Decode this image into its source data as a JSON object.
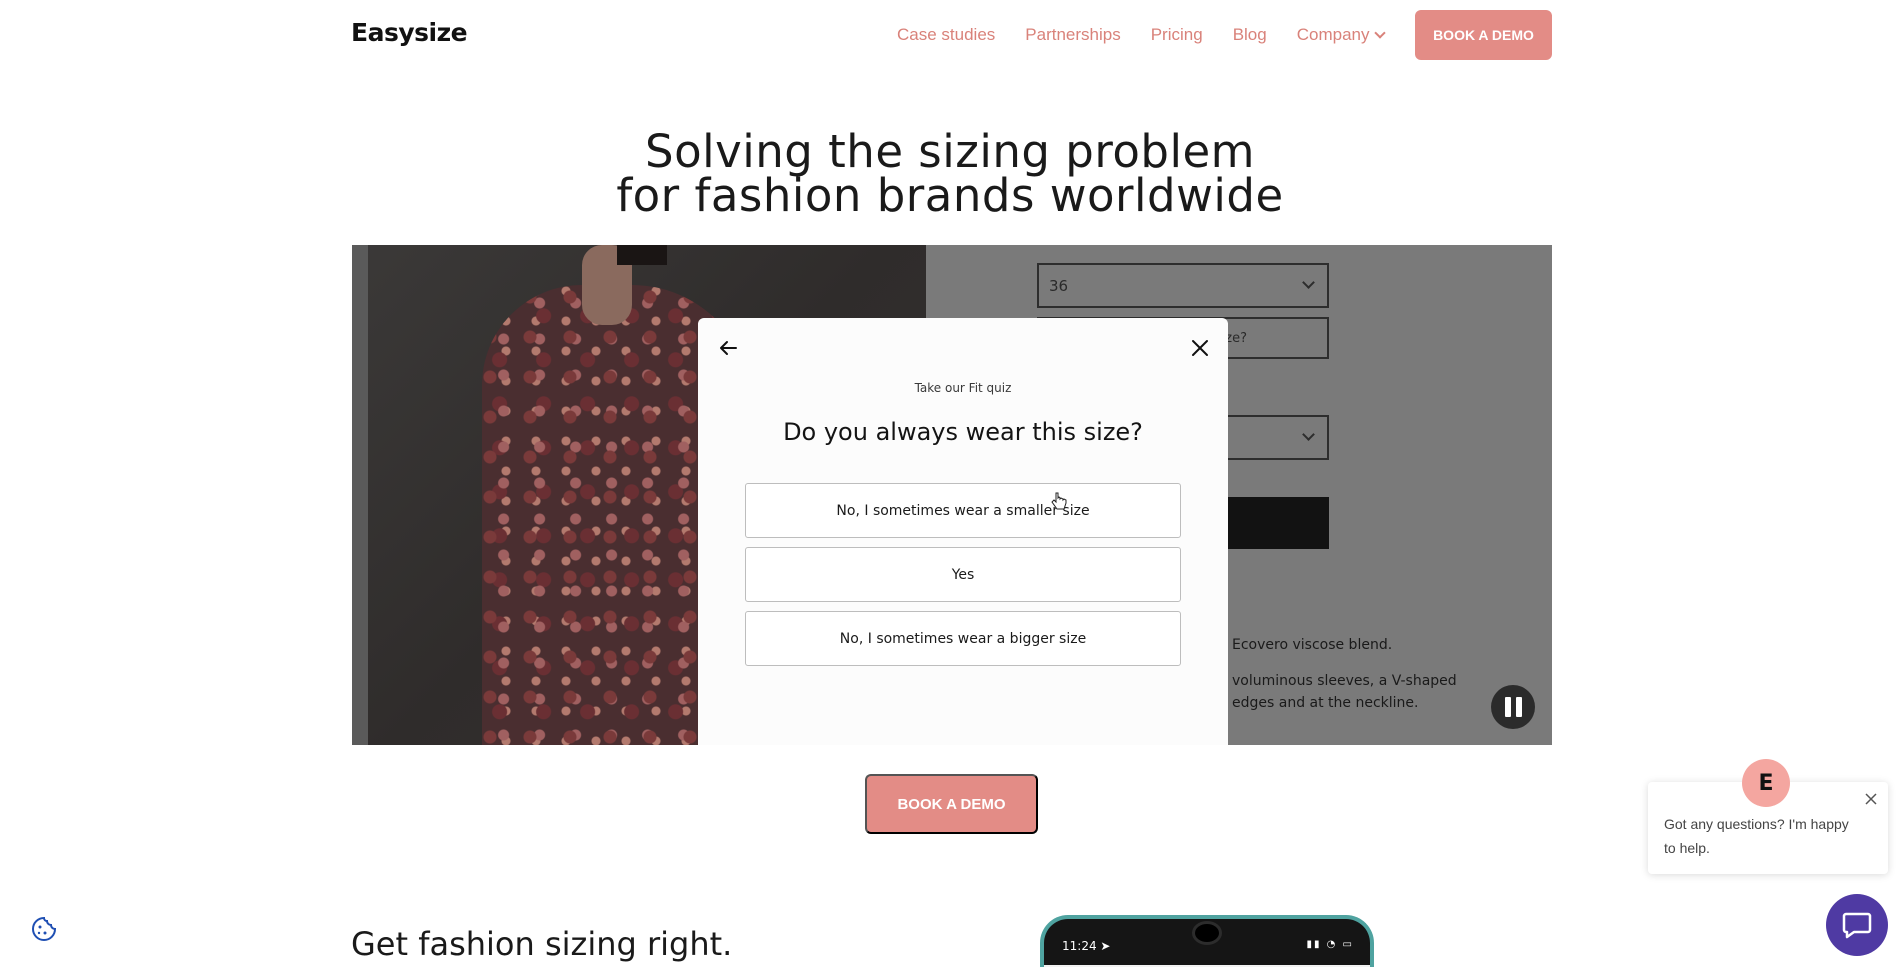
{
  "header": {
    "logo": "Easysize",
    "nav": [
      {
        "label": "Case studies"
      },
      {
        "label": "Partnerships"
      },
      {
        "label": "Pricing"
      },
      {
        "label": "Blog"
      },
      {
        "label": "Company"
      }
    ],
    "cta": "BOOK A DEMO"
  },
  "hero": {
    "title_line1": "Solving the sizing problem",
    "title_line2": "for fashion brands worldwide"
  },
  "video": {
    "size_value": "36",
    "size_button_text": "ze?",
    "desc_line1": "Ecovero viscose blend.",
    "desc_line2": "voluminous sleeves, a V-shaped",
    "desc_line3": "edges and at the neckline."
  },
  "quiz": {
    "label": "Take our Fit quiz",
    "question": "Do you always wear this size?",
    "options": [
      "No, I sometimes wear a smaller size",
      "Yes",
      "No, I sometimes wear a bigger size"
    ]
  },
  "cta_mid": "BOOK A DEMO",
  "section": {
    "title": "Get fashion sizing right."
  },
  "phone": {
    "time": "11:24"
  },
  "chat": {
    "avatar_letter": "E",
    "message": "Got any questions? I'm happy to help."
  },
  "colors": {
    "accent": "#e38c86",
    "nav_link": "#d9827a",
    "chat_launcher": "#4f3aa3"
  }
}
